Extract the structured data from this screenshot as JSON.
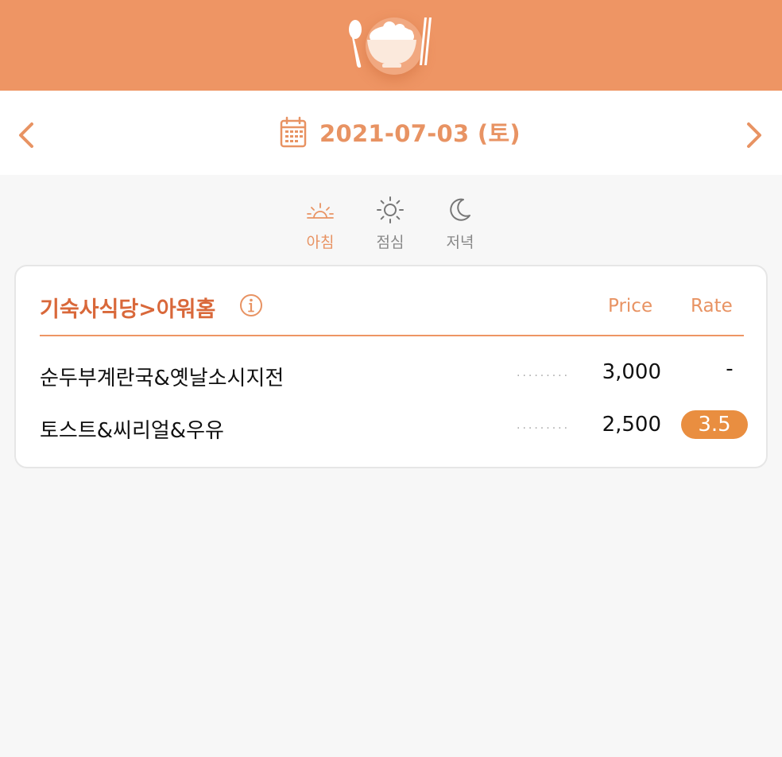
{
  "header": {
    "logo_icon": "rice-bowl-with-spoon-and-chopsticks-icon",
    "brand_color": "#ee9564"
  },
  "date_nav": {
    "prev_icon": "chevron-left-icon",
    "next_icon": "chevron-right-icon",
    "calendar_icon": "calendar-icon",
    "date": "2021-07-03 (토)"
  },
  "meal_tabs": [
    {
      "label": "아침",
      "icon": "sunrise-icon",
      "active": true
    },
    {
      "label": "점심",
      "icon": "sun-icon",
      "active": false
    },
    {
      "label": "저녁",
      "icon": "moon-icon",
      "active": false
    }
  ],
  "card": {
    "title": "기숙사식당>아워홈",
    "info_icon": "info-icon",
    "price_header": "Price",
    "rate_header": "Rate",
    "items": [
      {
        "name": "순두부계란국&옛날소시지전",
        "dots": "·········",
        "price": "3,000",
        "rate": "-"
      },
      {
        "name": "토스트&씨리얼&우유",
        "dots": "·········",
        "price": "2,500",
        "rate": "3.5"
      }
    ]
  },
  "colors": {
    "accent": "#e89363",
    "title": "#d9683a",
    "rate_badge": "#e98e40",
    "inactive": "#888888"
  }
}
